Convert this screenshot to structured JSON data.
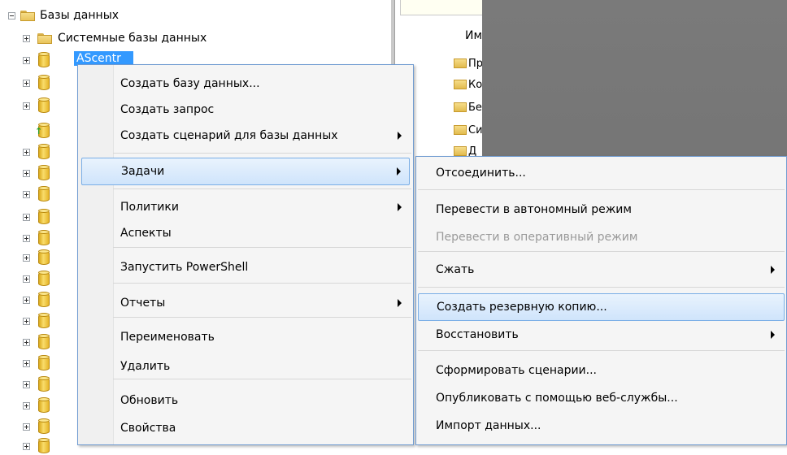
{
  "tree": {
    "root_label": "Базы данных",
    "system_db_label": "Системные базы данных",
    "selected_db_label": "AScentr",
    "db_rows": 19
  },
  "list": {
    "column_header": "Имя",
    "items": [
      "Пр",
      "Ко",
      "Бе",
      "Си",
      "Д"
    ]
  },
  "menu": {
    "items": [
      {
        "label": "Создать базу данных...",
        "submenu": false
      },
      {
        "label": "Создать запрос",
        "submenu": false
      },
      {
        "label": "Создать сценарий для базы данных",
        "submenu": true
      },
      {
        "label": "Задачи",
        "submenu": true
      },
      {
        "label": "Политики",
        "submenu": true
      },
      {
        "label": "Аспекты",
        "submenu": false
      },
      {
        "label": "Запустить PowerShell",
        "submenu": false
      },
      {
        "label": "Отчеты",
        "submenu": true
      },
      {
        "label": "Переименовать",
        "submenu": false
      },
      {
        "label": "Удалить",
        "submenu": false
      },
      {
        "label": "Обновить",
        "submenu": false
      },
      {
        "label": "Свойства",
        "submenu": false
      }
    ]
  },
  "submenu": {
    "items": [
      {
        "label": "Отсоединить...",
        "submenu": false,
        "disabled": false
      },
      {
        "label": "Перевести в автономный режим",
        "submenu": false,
        "disabled": false
      },
      {
        "label": "Перевести в оперативный режим",
        "submenu": false,
        "disabled": true
      },
      {
        "label": "Сжать",
        "submenu": true,
        "disabled": false
      },
      {
        "label": "Создать резервную копию...",
        "submenu": false,
        "disabled": false
      },
      {
        "label": "Восстановить",
        "submenu": true,
        "disabled": false
      },
      {
        "label": "Сформировать сценарии...",
        "submenu": false,
        "disabled": false
      },
      {
        "label": "Опубликовать с помощью веб-службы...",
        "submenu": false,
        "disabled": false
      },
      {
        "label": "Импорт данных...",
        "submenu": false,
        "disabled": false
      }
    ]
  },
  "colors": {
    "highlight_border": "#7aaee6",
    "highlight_fill": "#cfe4fb",
    "selection": "#3399ff"
  }
}
